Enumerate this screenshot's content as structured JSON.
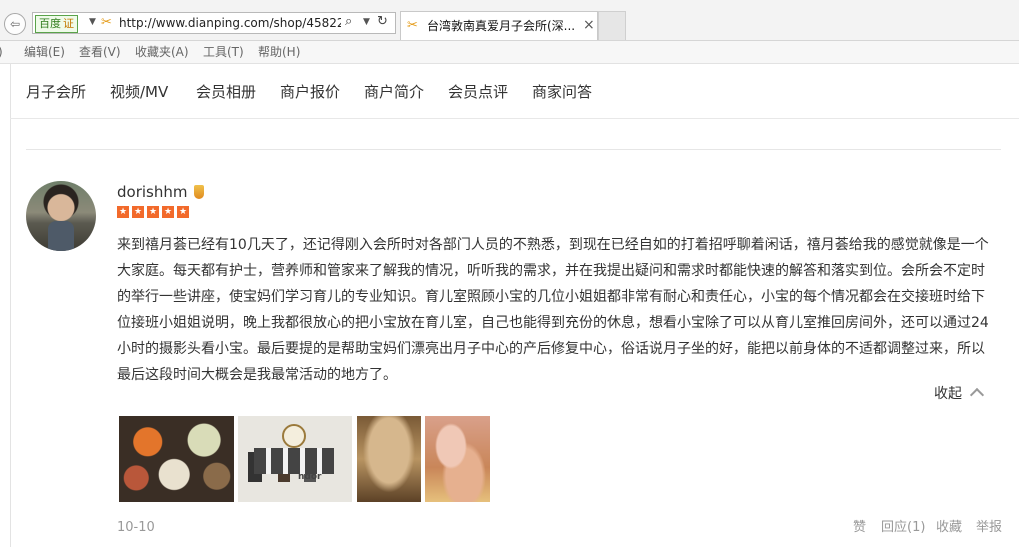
{
  "browser": {
    "search_engine": "百度",
    "cert_label": "证",
    "url": "http://www.dianping.com/shop/45822",
    "tab_title": "台湾敦南真爱月子会所(深...",
    "tab_close": "×"
  },
  "menu": {
    "items": [
      "编辑(E)",
      "查看(V)",
      "收藏夹(A)",
      "工具(T)",
      "帮助(H)"
    ]
  },
  "shop_nav": {
    "items": [
      "月子会所",
      "视频/MV",
      "会员相册",
      "商户报价",
      "商户简介",
      "会员点评",
      "商家问答"
    ]
  },
  "review": {
    "username": "dorishhm",
    "rating": 5,
    "text": "来到禧月荟已经有10几天了，还记得刚入会所时对各部门人员的不熟悉，到现在已经自如的打着招呼聊着闲话，禧月荟给我的感觉就像是一个大家庭。每天都有护士，营养师和管家来了解我的情况，听听我的需求，并在我提出疑问和需求时都能快速的解答和落实到位。会所会不定时的举行一些讲座，使宝妈们学习育儿的专业知识。育儿室照顾小宝的几位小姐姐都非常有耐心和责任心，小宝的每个情况都会在交接班时给下位接班小姐姐说明，晚上我都很放心的把小宝放在育儿室，自己也能得到充份的休息，想看小宝除了可以从育儿室推回房间外，还可以通过24小时的摄影头看小宝。最后要提的是帮助宝妈们漂亮出月子中心的产后修复中心，俗话说月子坐的好，能把以前身体的不适都调整过来，所以最后这段时间大概会是我最常活动的地方了。",
    "collapse_label": "收起",
    "photo_text": "ndor",
    "date": "10-10",
    "actions": {
      "like": "赞",
      "reply": "回应(1)",
      "favorite": "收藏",
      "report": "举报"
    }
  },
  "colors": {
    "star": "#f26a2b",
    "text": "#333333",
    "muted": "#999999"
  }
}
